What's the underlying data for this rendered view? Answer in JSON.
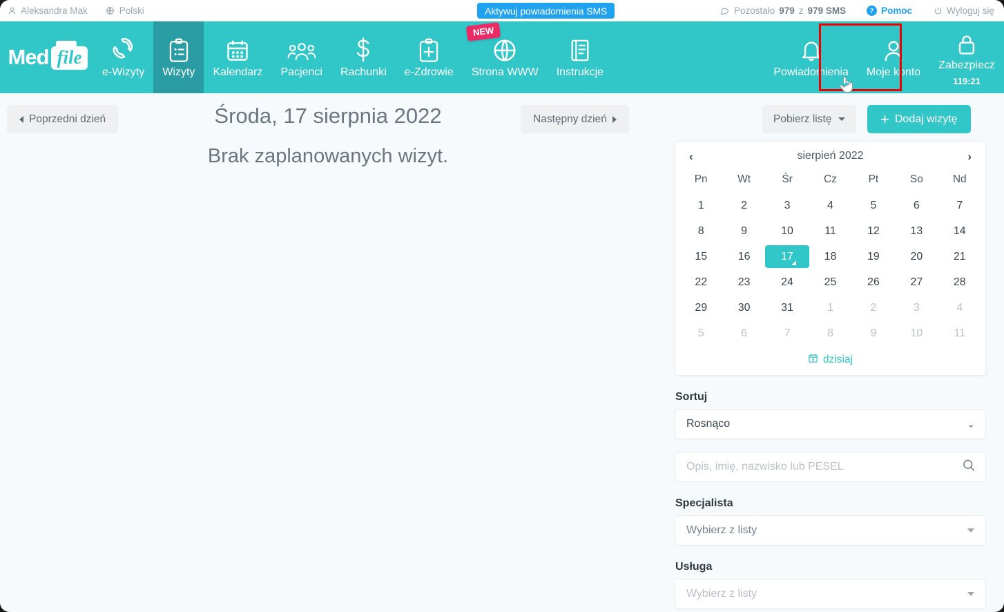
{
  "topbar": {
    "user": "Aleksandra Mak",
    "language": "Polski",
    "sms_button": "Aktywuj powiadomienia SMS",
    "sms_status_prefix": "Pozostało",
    "sms_remaining": "979",
    "sms_of": "z",
    "sms_total": "979 SMS",
    "help": "Pomoc",
    "logout": "Wyloguj się"
  },
  "nav": {
    "logo_med": "Med",
    "logo_file": "file",
    "items": [
      {
        "label": "e-Wizyty",
        "icon": "phone-icon",
        "active": false
      },
      {
        "label": "Wizyty",
        "icon": "clipboard-list-icon",
        "active": true
      },
      {
        "label": "Kalendarz",
        "icon": "calendar-icon",
        "active": false
      },
      {
        "label": "Pacjenci",
        "icon": "users-icon",
        "active": false
      },
      {
        "label": "Rachunki",
        "icon": "dollar-icon",
        "active": false
      },
      {
        "label": "e-Zdrowie",
        "icon": "clipboard-plus-icon",
        "active": false
      },
      {
        "label": "Strona WWW",
        "icon": "globe-icon",
        "active": false,
        "badge": "NEW"
      },
      {
        "label": "Instrukcje",
        "icon": "book-icon",
        "active": false
      }
    ],
    "right_items": [
      {
        "label": "Powiadomienia",
        "icon": "bell-icon"
      },
      {
        "label": "Moje konto",
        "icon": "user-icon",
        "highlighted": true
      },
      {
        "label": "Zabezpiecz",
        "icon": "lock-icon",
        "sub": "119:21"
      }
    ]
  },
  "toolbar": {
    "prev_day": "Poprzedni dzień",
    "next_day": "Następny dzień",
    "download_list": "Pobierz listę",
    "add_visit": "Dodaj wizytę",
    "add_visit_plus": "+"
  },
  "main": {
    "day_title": "Środa, 17 sierpnia 2022",
    "no_visits": "Brak zaplanowanych wizyt."
  },
  "calendar": {
    "prev_arrow": "‹",
    "next_arrow": "›",
    "title": "sierpień 2022",
    "dow": [
      "Pn",
      "Wt",
      "Śr",
      "Cz",
      "Pt",
      "So",
      "Nd"
    ],
    "today_label": "dzisiaj",
    "selected_day": 17,
    "weeks": [
      [
        {
          "d": "1"
        },
        {
          "d": "2"
        },
        {
          "d": "3"
        },
        {
          "d": "4"
        },
        {
          "d": "5"
        },
        {
          "d": "6"
        },
        {
          "d": "7"
        }
      ],
      [
        {
          "d": "8"
        },
        {
          "d": "9"
        },
        {
          "d": "10"
        },
        {
          "d": "11"
        },
        {
          "d": "12"
        },
        {
          "d": "13"
        },
        {
          "d": "14"
        }
      ],
      [
        {
          "d": "15"
        },
        {
          "d": "16"
        },
        {
          "d": "17",
          "sel": true
        },
        {
          "d": "18"
        },
        {
          "d": "19"
        },
        {
          "d": "20"
        },
        {
          "d": "21"
        }
      ],
      [
        {
          "d": "22"
        },
        {
          "d": "23"
        },
        {
          "d": "24"
        },
        {
          "d": "25"
        },
        {
          "d": "26"
        },
        {
          "d": "27"
        },
        {
          "d": "28"
        }
      ],
      [
        {
          "d": "29"
        },
        {
          "d": "30"
        },
        {
          "d": "31"
        },
        {
          "d": "1",
          "muted": true
        },
        {
          "d": "2",
          "muted": true
        },
        {
          "d": "3",
          "muted": true
        },
        {
          "d": "4",
          "muted": true
        }
      ],
      [
        {
          "d": "5",
          "muted": true
        },
        {
          "d": "6",
          "muted": true
        },
        {
          "d": "7",
          "muted": true
        },
        {
          "d": "8",
          "muted": true
        },
        {
          "d": "9",
          "muted": true
        },
        {
          "d": "10",
          "muted": true
        },
        {
          "d": "11",
          "muted": true
        }
      ]
    ]
  },
  "filters": {
    "sort_label": "Sortuj",
    "sort_value": "Rosnąco",
    "search_placeholder": "Opis, imię, nazwisko lub PESEL",
    "specialist_label": "Specjalista",
    "specialist_value": "Wybierz z listy",
    "service_label": "Usługa",
    "service_value": "Wybierz z listy"
  },
  "colors": {
    "teal": "#31c6c8",
    "teal_active": "#2a9ca4",
    "blue": "#1fa2f0",
    "pink": "#ec2a66",
    "highlight_red": "#ee0000",
    "page_bg": "#f6fafc"
  }
}
